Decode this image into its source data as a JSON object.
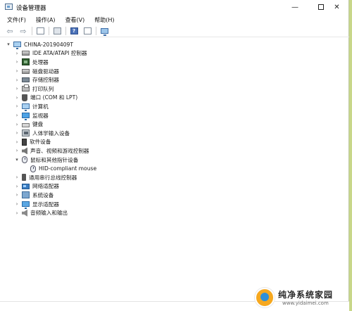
{
  "window": {
    "title": "设备管理器",
    "controls": {
      "minimize": "—",
      "close": "✕"
    }
  },
  "menu": [
    "文件(F)",
    "操作(A)",
    "查看(V)",
    "帮助(H)"
  ],
  "toolbar": [
    "back-icon",
    "forward-icon",
    "properties-icon",
    "view-icon",
    "help-icon",
    "list-icon",
    "scan-monitor-icon"
  ],
  "tree": {
    "root": "CHINA-20190409T",
    "items": [
      {
        "label": "IDE ATA/ATAPI 控制器",
        "icon": "disk-controller-icon",
        "expanded": false
      },
      {
        "label": "处理器",
        "icon": "processor-icon",
        "expanded": false
      },
      {
        "label": "磁盘驱动器",
        "icon": "disk-drive-icon",
        "expanded": false
      },
      {
        "label": "存储控制器",
        "icon": "storage-controller-icon",
        "expanded": false
      },
      {
        "label": "打印队列",
        "icon": "printer-icon",
        "expanded": false
      },
      {
        "label": "端口 (COM 和 LPT)",
        "icon": "port-icon",
        "expanded": false
      },
      {
        "label": "计算机",
        "icon": "computer-icon",
        "expanded": false
      },
      {
        "label": "监视器",
        "icon": "monitor-icon",
        "expanded": false
      },
      {
        "label": "键盘",
        "icon": "keyboard-icon",
        "expanded": false
      },
      {
        "label": "人体学输入设备",
        "icon": "hid-icon",
        "expanded": false
      },
      {
        "label": "软件设备",
        "icon": "software-device-icon",
        "expanded": false
      },
      {
        "label": "声音、视频和游戏控制器",
        "icon": "sound-icon",
        "expanded": false
      },
      {
        "label": "鼠标和其他指针设备",
        "icon": "mouse-icon",
        "expanded": true,
        "children": [
          "HID-compliant mouse"
        ]
      },
      {
        "label": "通用串行总线控制器",
        "icon": "usb-icon",
        "expanded": false
      },
      {
        "label": "网络适配器",
        "icon": "network-adapter-icon",
        "expanded": false
      },
      {
        "label": "系统设备",
        "icon": "system-device-icon",
        "expanded": false
      },
      {
        "label": "显示适配器",
        "icon": "display-adapter-icon",
        "expanded": false
      },
      {
        "label": "音频输入和输出",
        "icon": "audio-io-icon",
        "expanded": false
      }
    ]
  },
  "watermark": {
    "title": "纯净系统家园",
    "url": "www.yidaimei.com"
  }
}
